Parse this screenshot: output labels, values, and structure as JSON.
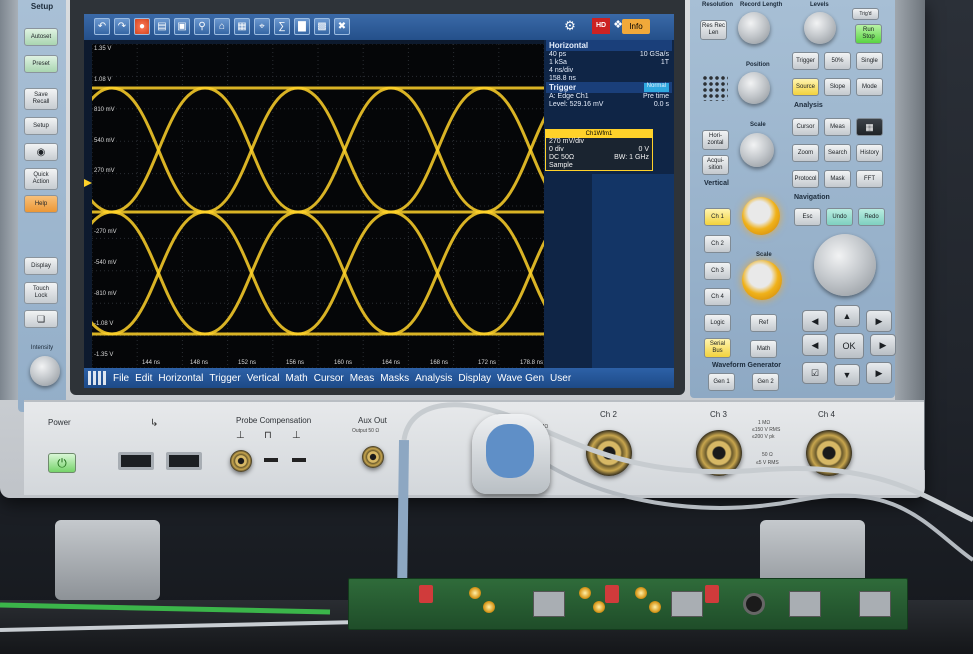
{
  "toolbar": {
    "icons": [
      "undo-icon",
      "redo-icon",
      "stop-icon",
      "folder-icon",
      "screenshot-icon",
      "search-icon",
      "home-icon",
      "mask-icon",
      "cursor-icon",
      "math-icon",
      "histogram-icon",
      "grid-icon",
      "delete-icon"
    ],
    "hd": "HD",
    "info": "Info"
  },
  "plot": {
    "y_labels": [
      "1.35 V",
      "1.08 V",
      "810 mV",
      "540 mV",
      "270 mV",
      "-270 mV",
      "-540 mV",
      "-810 mV",
      "-1.08 V",
      "-1.35 V"
    ],
    "x_labels": [
      "144 ns",
      "148 ns",
      "152 ns",
      "156 ns",
      "160 ns",
      "164 ns",
      "168 ns",
      "172 ns",
      "178.8 ns"
    ],
    "trace_color": "#ffd22a"
  },
  "horizontal": {
    "title": "Horizontal",
    "rows": [
      [
        "40 ps",
        "10 GSa/s"
      ],
      [
        "1 kSa",
        "1T"
      ],
      [
        "4 ns/div",
        ""
      ],
      [
        "158.8 ns",
        ""
      ]
    ]
  },
  "trigger": {
    "title": "Trigger",
    "mode": "Normal",
    "rows": [
      [
        "A: Edge  Ch1",
        "Pre time"
      ],
      [
        "Level: 529.16 mV",
        "0.0 s"
      ]
    ]
  },
  "ch1": {
    "header": "Ch1Wfm1",
    "rows": [
      [
        "270 mV/div",
        ""
      ],
      [
        "0 div",
        "0 V"
      ],
      [
        "DC 50Ω",
        "BW: 1 GHz"
      ],
      [
        "Sample",
        ""
      ]
    ]
  },
  "menu": [
    "File",
    "Edit",
    "Horizontal",
    "Trigger",
    "Vertical",
    "Math",
    "Cursor",
    "Meas",
    "Masks",
    "Analysis",
    "Display",
    "Wave Gen",
    "User"
  ],
  "left_panel": {
    "setup_label": "Setup",
    "autoset": "Autoset",
    "preset": "Preset",
    "save_recall": "Save Recall",
    "setup": "Setup",
    "quick_action": "Quick Action",
    "help": "Help",
    "display": "Display",
    "touch_lock": "Touch Lock",
    "intensity": "Intensity"
  },
  "right_panel": {
    "resolution": "Resolution",
    "record_length": "Record Length",
    "res_rec_len": "Res Rec Len",
    "position": "Position",
    "scale": "Scale",
    "horizontal": "Hori-zontal",
    "acquisition": "Acqui-sition",
    "vertical": "Vertical",
    "levels": "Levels",
    "trig_d": "Trig'd",
    "run_stop": "Run Stop",
    "trigger": "Trigger",
    "fifty": "50%",
    "single": "Single",
    "source": "Source",
    "slope": "Slope",
    "mode": "Mode",
    "analysis": "Analysis",
    "cursor": "Cursor",
    "meas": "Meas",
    "zoom": "Zoom",
    "search": "Search",
    "history": "History",
    "protocol": "Protocol",
    "mask": "Mask",
    "fft": "FFT",
    "navigation": "Navigation",
    "esc": "Esc",
    "undo": "Undo",
    "redo": "Redo",
    "ok": "OK",
    "ch1": "Ch 1",
    "ch2": "Ch 2",
    "ch3": "Ch 3",
    "ch4": "Ch 4",
    "logic": "Logic",
    "ref": "Ref",
    "serial_bus": "Serial Bus",
    "math": "Math",
    "waveform_generator": "Waveform Generator",
    "gen1": "Gen 1",
    "gen2": "Gen 2"
  },
  "front": {
    "power": "Power",
    "probe_compensation": "Probe Compensation",
    "aux_out": "Aux Out",
    "aux_out_sub": "Output 50 Ω",
    "ch2": "Ch 2",
    "ch3": "Ch 3",
    "ch4": "Ch 4",
    "rating1": "1 MΩ",
    "rating2": "≤150 V RMS",
    "rating3": "≤200 V pk",
    "rating4": "50 Ω",
    "rating5": "≤5 V RMS"
  }
}
